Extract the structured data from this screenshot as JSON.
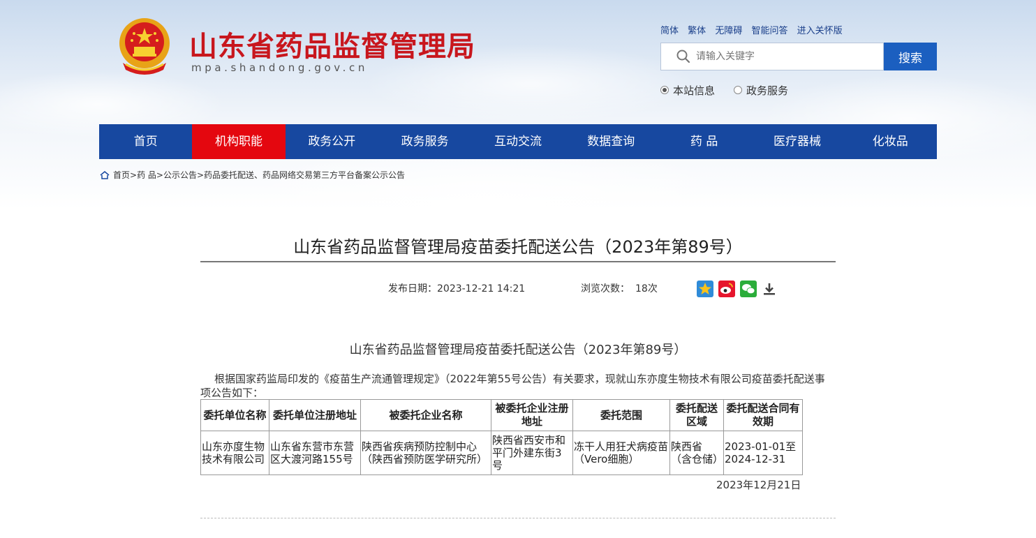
{
  "header": {
    "site_title": "山东省药品监督管理局",
    "site_domain": "mpa.shandong.gov.cn",
    "top_links": [
      "简体",
      "繁体",
      "无障碍",
      "智能问答",
      "进入关怀版"
    ],
    "search": {
      "placeholder": "请输入关键字",
      "button": "搜索"
    },
    "scope_options": [
      {
        "label": "本站信息",
        "checked": true
      },
      {
        "label": "政务服务",
        "checked": false
      }
    ]
  },
  "nav": {
    "items": [
      "首页",
      "机构职能",
      "政务公开",
      "政务服务",
      "互动交流",
      "数据查询",
      "药 品",
      "医疗器械",
      "化妆品"
    ],
    "active_index": 1
  },
  "breadcrumb": {
    "items": [
      "首页",
      "药 品",
      "公示公告",
      "药品委托配送、药品网络交易第三方平台备案公示公告"
    ],
    "separator": ">"
  },
  "article": {
    "title": "山东省药品监督管理局疫苗委托配送公告（2023年第89号）",
    "publish_label": "发布日期：",
    "publish_date": "2023-12-21 14:21",
    "views_label": "浏览次数：",
    "views": "18次",
    "share_icons": [
      "qzone-icon",
      "weibo-icon",
      "wechat-icon",
      "download-icon"
    ],
    "subtitle": "山东省药品监督管理局疫苗委托配送公告（2023年第89号）",
    "paragraph": "根据国家药监局印发的《疫苗生产流通管理规定》（2022年第55号公告）有关要求，现就山东亦度生物技术有限公司疫苗委托配送事项公告如下：",
    "table": {
      "headers": [
        "委托单位名称",
        "委托单位注册地址",
        "被委托企业名称",
        "被委托企业注册地址",
        "委托范围",
        "委托配送区域",
        "委托配送合同有效期"
      ],
      "rows": [
        [
          "山东亦度生物技术有限公司",
          "山东省东营市东营区大渡河路155号",
          "陕西省疾病预防控制中心（陕西省预防医学研究所）",
          "陕西省西安市和平门外建东街3号",
          "冻干人用狂犬病疫苗（Vero细胞）",
          "陕西省（含仓储）",
          "2023-01-01至2024-12-31"
        ]
      ]
    },
    "sign_date": "2023年12月21日"
  },
  "colors": {
    "brand_red": "#c8161d",
    "nav_blue": "#1748a0",
    "nav_active": "#e4070f",
    "search_button": "#1b5fc0"
  }
}
